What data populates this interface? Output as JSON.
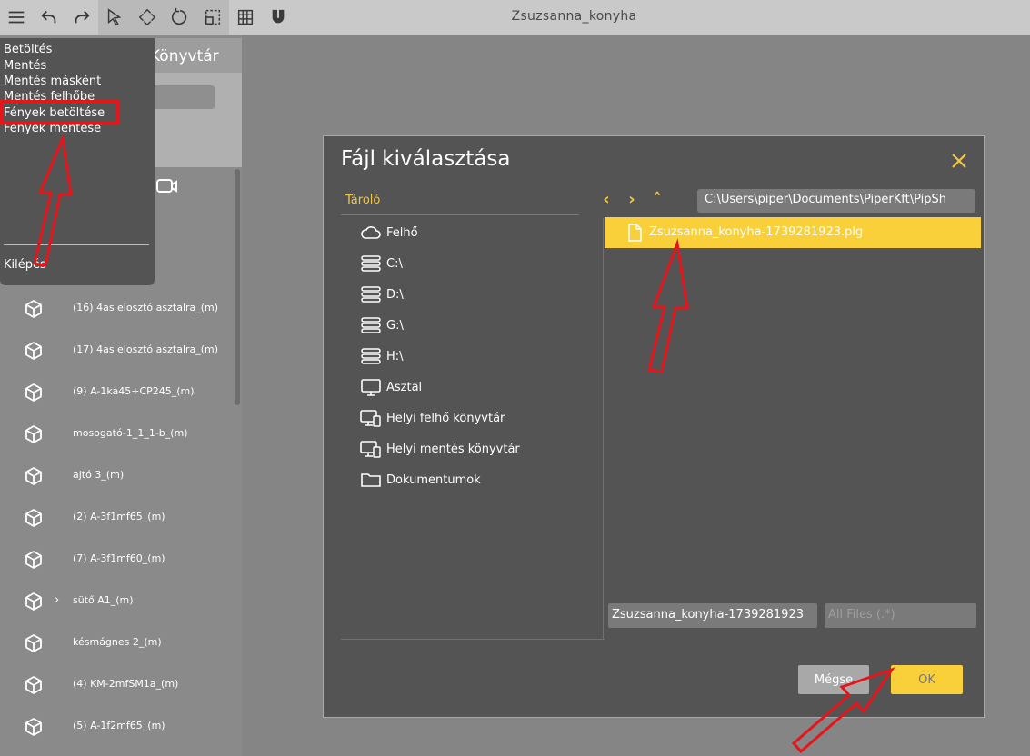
{
  "app": {
    "title": "Zsuzsanna_konyha"
  },
  "toolbar": {
    "icons": [
      "menu-icon",
      "undo-icon",
      "redo-icon",
      "select-arrow-icon",
      "move-icon",
      "rotate-icon",
      "scale-icon",
      "grid-icon",
      "magnet-icon"
    ]
  },
  "left_panel": {
    "header_visible_text": "Könyvtár",
    "objects": [
      {
        "label": "(16) 4as elosztó asztalra_(m)",
        "expandable": false
      },
      {
        "label": "(17) 4as elosztó asztalra_(m)",
        "expandable": false
      },
      {
        "label": "(9) A-1ka45+CP245_(m)",
        "expandable": false
      },
      {
        "label": "mosogató-1_1_1-b_(m)",
        "expandable": false
      },
      {
        "label": "ajtó 3_(m)",
        "expandable": false
      },
      {
        "label": "(2) A-3f1mf65_(m)",
        "expandable": false
      },
      {
        "label": "(7) A-3f1mf60_(m)",
        "expandable": false
      },
      {
        "label": "sütő A1_(m)",
        "expandable": true
      },
      {
        "label": "késmágnes 2_(m)",
        "expandable": false
      },
      {
        "label": "(4) KM-2mfSM1a_(m)",
        "expandable": false
      },
      {
        "label": "(5) A-1f2mf65_(m)",
        "expandable": false
      }
    ]
  },
  "menu": {
    "items": [
      "Betöltés",
      "Mentés",
      "Mentés másként",
      "Mentés felhőbe",
      "Fények betöltése",
      "Fények mentése"
    ],
    "exit": "Kilépés",
    "highlighted_item": "Fények betöltése"
  },
  "dialog": {
    "title": "Fájl kiválasztása",
    "storage_label": "Tároló",
    "locations": [
      {
        "label": "Felhő",
        "icon": "cloud-icon"
      },
      {
        "label": "C:\\",
        "icon": "drive-icon"
      },
      {
        "label": "D:\\",
        "icon": "drive-icon"
      },
      {
        "label": "G:\\",
        "icon": "drive-icon"
      },
      {
        "label": "H:\\",
        "icon": "drive-icon"
      },
      {
        "label": "Asztal",
        "icon": "desktop-icon"
      },
      {
        "label": "Helyi felhő könyvtár",
        "icon": "computer-icon"
      },
      {
        "label": "Helyi mentés könyvtár",
        "icon": "computer-icon"
      },
      {
        "label": "Dokumentumok",
        "icon": "folder-icon"
      }
    ],
    "nav": {
      "back": "‹",
      "forward": "›",
      "up": "˄"
    },
    "path": "C:\\Users\\piper\\Documents\\PiperKft\\PipSh",
    "files": [
      {
        "name": "Zsuzsanna_konyha-1739281923.plg",
        "selected": true
      }
    ],
    "filename_value": "Zsuzsanna_konyha-1739281923",
    "filter_placeholder": "All Files (.*)",
    "cancel_label": "Mégse",
    "ok_label": "OK"
  },
  "colors": {
    "accent": "#f9cf3a",
    "dialog_bg": "#545454",
    "annotation": "#e5161b"
  }
}
